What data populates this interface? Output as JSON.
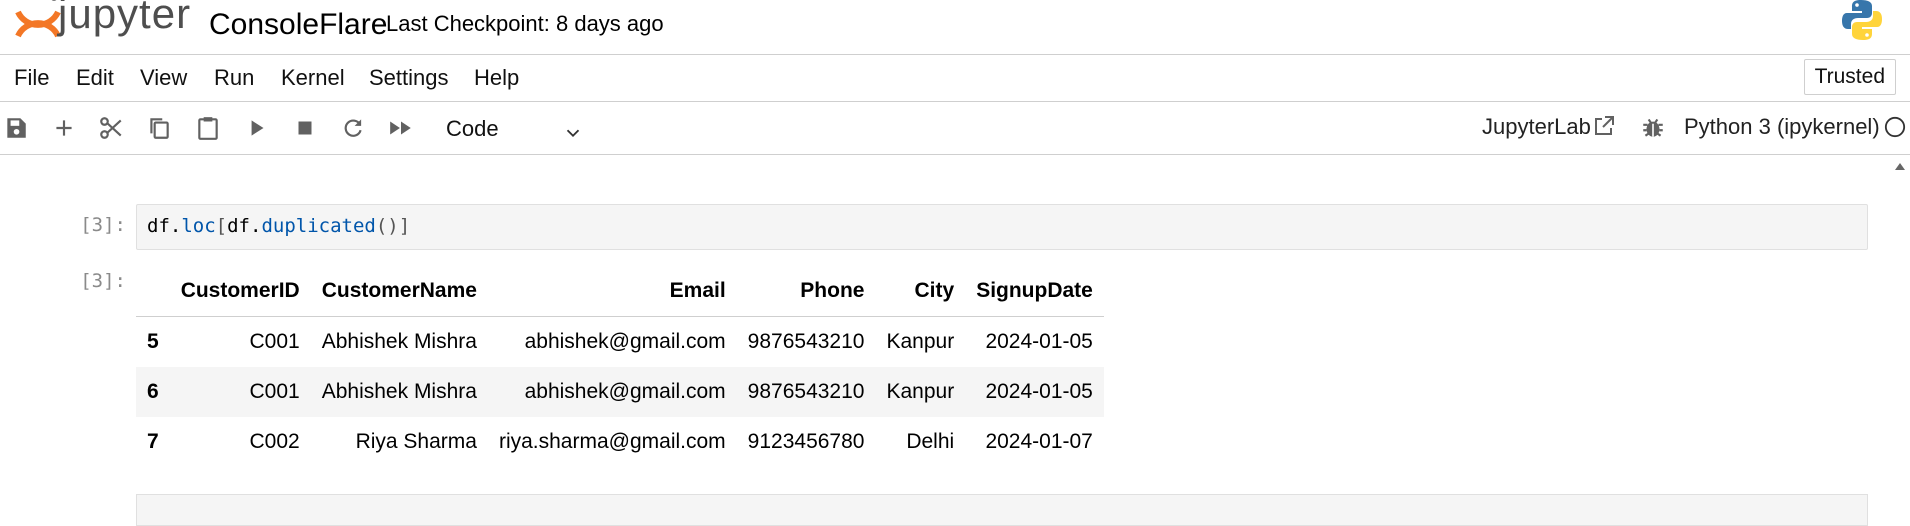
{
  "header": {
    "logo_text": "jupyter",
    "notebook_title": "ConsoleFlare",
    "checkpoint": "Last Checkpoint: 8 days ago"
  },
  "menu": {
    "items": [
      "File",
      "Edit",
      "View",
      "Run",
      "Kernel",
      "Settings",
      "Help"
    ],
    "trusted": "Trusted"
  },
  "toolbar": {
    "buttons": [
      "save-icon",
      "plus-icon",
      "scissors-icon",
      "copy-icon",
      "paste-icon",
      "run-icon",
      "stop-icon",
      "restart-icon",
      "fast-forward-icon"
    ],
    "cell_type": "Code",
    "jupyterlab_link": "JupyterLab",
    "kernel_name": "Python 3 (ipykernel)"
  },
  "cells": {
    "input_prompt": "[3]:",
    "code": "df.loc[df.duplicated()]",
    "output_prompt": "[3]:"
  },
  "dataframe": {
    "columns": [
      "",
      "CustomerID",
      "CustomerName",
      "Email",
      "Phone",
      "City",
      "SignupDate"
    ],
    "rows": [
      {
        "index": "5",
        "cells": [
          "C001",
          "Abhishek Mishra",
          "abhishek@gmail.com",
          "9876543210",
          "Kanpur",
          "2024-01-05"
        ]
      },
      {
        "index": "6",
        "cells": [
          "C001",
          "Abhishek Mishra",
          "abhishek@gmail.com",
          "9876543210",
          "Kanpur",
          "2024-01-05"
        ]
      },
      {
        "index": "7",
        "cells": [
          "C002",
          "Riya Sharma",
          "riya.sharma@gmail.com",
          "9123456780",
          "Delhi",
          "2024-01-07"
        ]
      }
    ]
  },
  "colors": {
    "jupyter_orange": "#f37726",
    "python_blue": "#3776ab",
    "python_yellow": "#ffd43b",
    "code_function": "#0055aa"
  }
}
